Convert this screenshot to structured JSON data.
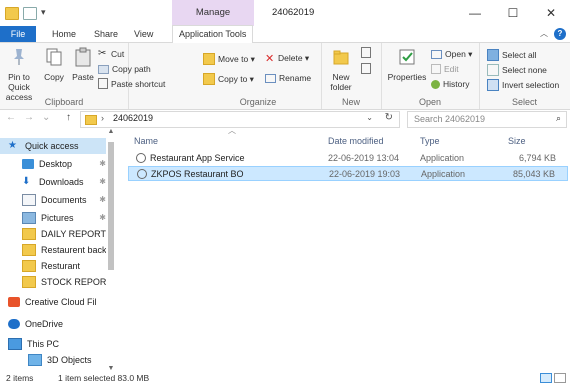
{
  "window": {
    "title": "24062019",
    "context_tab": "Manage",
    "buttons": {
      "minimize": "—",
      "maximize": "☐",
      "close": "✕"
    }
  },
  "tabs": [
    "File",
    "Home",
    "Share",
    "View",
    "Application Tools"
  ],
  "ribbon": {
    "clipboard": {
      "label": "Clipboard",
      "pin": "Pin to Quick access",
      "copy": "Copy",
      "paste": "Paste",
      "cut": "Cut",
      "copy_path": "Copy path",
      "paste_shortcut": "Paste shortcut"
    },
    "organize": {
      "label": "Organize",
      "move_to": "Move to ▾",
      "copy_to": "Copy to ▾",
      "delete": "Delete ▾",
      "rename": "Rename"
    },
    "new": {
      "label": "New",
      "new_folder": "New folder"
    },
    "open": {
      "label": "Open",
      "properties": "Properties",
      "open": "Open ▾",
      "edit": "Edit",
      "history": "History"
    },
    "select": {
      "label": "Select",
      "select_all": "Select all",
      "select_none": "Select none",
      "invert": "Invert selection"
    }
  },
  "address": {
    "path": "24062019",
    "search_placeholder": "Search 24062019"
  },
  "nav": {
    "items": [
      {
        "label": "Quick access",
        "icon": "star-icon",
        "selected": true
      },
      {
        "label": "Desktop",
        "icon": "desktop-icon",
        "pinned": true
      },
      {
        "label": "Downloads",
        "icon": "download-icon",
        "pinned": true
      },
      {
        "label": "Documents",
        "icon": "documents-icon",
        "pinned": true
      },
      {
        "label": "Pictures",
        "icon": "pictures-icon",
        "pinned": true
      },
      {
        "label": "DAILY REPORT",
        "icon": "folder-icon"
      },
      {
        "label": "Restaurent backu",
        "icon": "folder-icon"
      },
      {
        "label": "Resturant",
        "icon": "folder-icon"
      },
      {
        "label": "STOCK REPORT",
        "icon": "folder-icon"
      },
      {
        "label": "Creative Cloud Fil",
        "icon": "creative-cloud-icon"
      },
      {
        "label": "OneDrive",
        "icon": "onedrive-icon"
      },
      {
        "label": "This PC",
        "icon": "computer-icon"
      },
      {
        "label": "3D Objects",
        "icon": "3d-objects-icon"
      }
    ]
  },
  "columns": {
    "name": "Name",
    "date": "Date modified",
    "type": "Type",
    "size": "Size"
  },
  "files": [
    {
      "name": "Restaurant App Service",
      "date": "22-06-2019 13:04",
      "type": "Application",
      "size": "6,794 KB",
      "selected": false
    },
    {
      "name": "ZKPOS Restaurant BO",
      "date": "22-06-2019 19:03",
      "type": "Application",
      "size": "85,043 KB",
      "selected": true
    }
  ],
  "status": {
    "items": "2 items",
    "selected": "1 item selected  83.0 MB"
  },
  "colors": {
    "accent": "#1e6fc9",
    "selection": "#cce8ff",
    "manage_tab": "#e8d7f2",
    "folder": "#f2c94c"
  }
}
